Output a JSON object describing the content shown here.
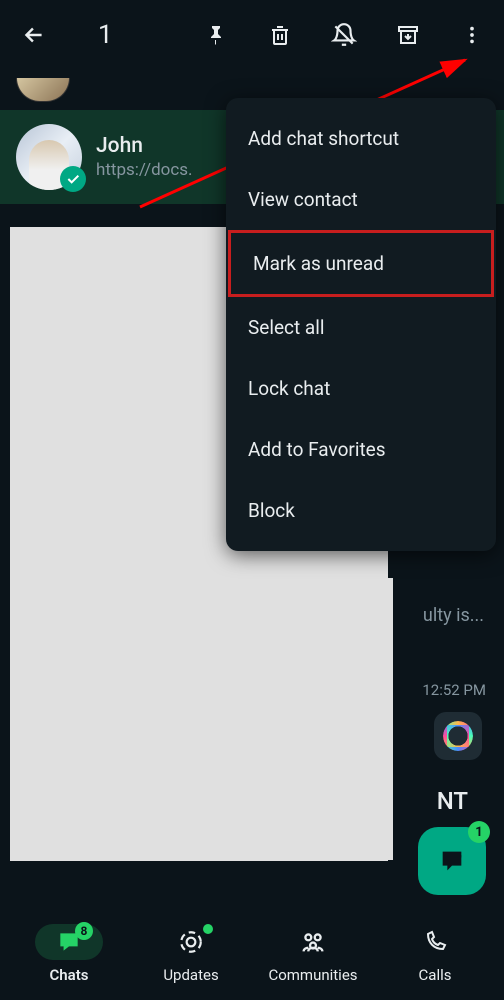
{
  "header": {
    "selected_count": "1"
  },
  "partial_chat": {
    "preview": ""
  },
  "selected_chat": {
    "name": "John",
    "preview": "https://docs."
  },
  "menu": {
    "items": [
      {
        "label": "Add chat shortcut",
        "highlighted": false
      },
      {
        "label": "View contact",
        "highlighted": false
      },
      {
        "label": "Mark as unread",
        "highlighted": true
      },
      {
        "label": "Select all",
        "highlighted": false
      },
      {
        "label": "Lock chat",
        "highlighted": false
      },
      {
        "label": "Add to Favorites",
        "highlighted": false
      },
      {
        "label": "Block",
        "highlighted": false
      }
    ]
  },
  "background": {
    "truncated_text": "ulty is...",
    "timestamp": "12:52 PM",
    "partial_label": "NT"
  },
  "fab": {
    "badge": "1"
  },
  "nav": {
    "items": [
      {
        "label": "Chats",
        "badge": "8",
        "active": true
      },
      {
        "label": "Updates",
        "badge": "",
        "active": false,
        "dot": true
      },
      {
        "label": "Communities",
        "badge": "",
        "active": false
      },
      {
        "label": "Calls",
        "badge": "",
        "active": false
      }
    ]
  },
  "colors": {
    "accent": "#00a884",
    "highlight_border": "#c81e1e"
  }
}
